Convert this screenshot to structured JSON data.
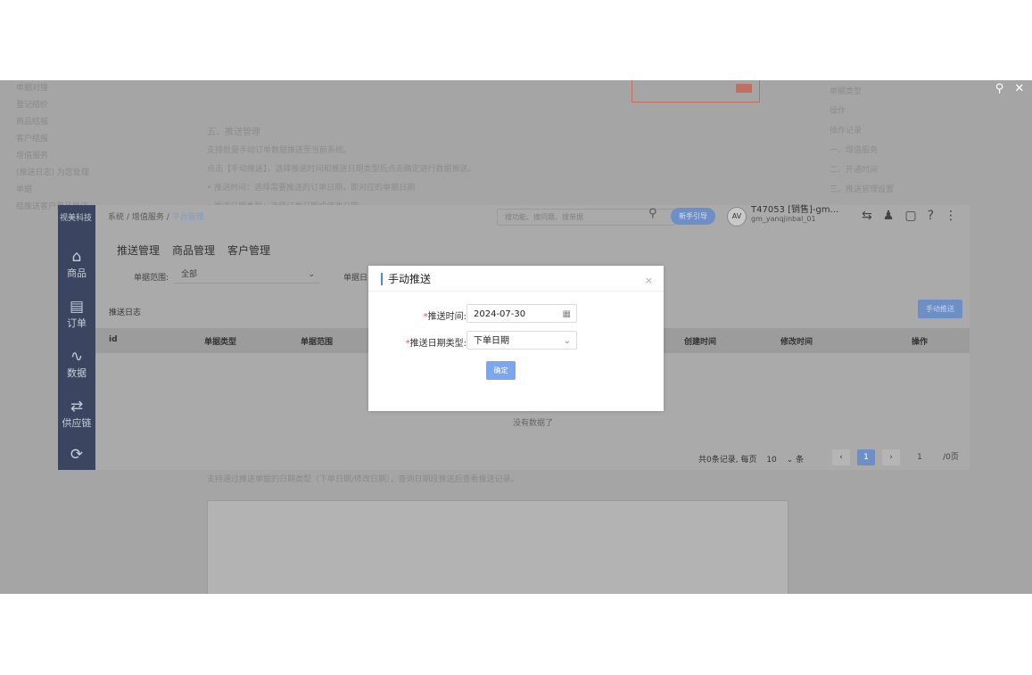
{
  "viewer": {
    "zoom_icon": "search-icon",
    "close_icon": "close-icon",
    "zoom_glyph": "⚲",
    "close_glyph": "✕"
  },
  "doc": {
    "sidebar_items": [
      "单据对接",
      "登记结价",
      "商品结报",
      "客户结报",
      "增值服务",
      "(推送日志) 为您处理单据",
      "结推送客户商品推送"
    ],
    "heading": "五、推送管理",
    "paragraphs": [
      "支持批量手动订单数据推送至当前系统。",
      "点击【手动推送】，选择推送时间和推送日期类型后点击确定进行数据推送。",
      "• 推送时间：选择需要推送的订单日期，即对应的单据日期",
      "• 推送日期类型：选择订单日期或修改日期"
    ],
    "right_items": [
      "单据类型",
      "操作",
      "操作记录",
      "一、增值服务",
      "二、开通时间",
      "三、推送管理设置"
    ],
    "bottom_line": "支持通过推送单据的日期类型（下单日期/修改日期），查询日期段推送后查看推送记录。"
  },
  "app": {
    "brand": "视美科技",
    "nav": [
      {
        "label": "商品",
        "glyph": "⌂"
      },
      {
        "label": "订单",
        "glyph": "▤"
      },
      {
        "label": "数据",
        "glyph": "∿"
      },
      {
        "label": "供应链",
        "glyph": "⇄"
      },
      {
        "label": "",
        "glyph": "⟳"
      }
    ],
    "breadcrumb": {
      "a": "系统",
      "b": "增值服务",
      "c": "平台管理",
      "sep": "/"
    },
    "search_placeholder": "搜功能、搜问题、搜单据",
    "search_glyph": "⚲",
    "new_button": "新手引导",
    "avatar": "AV",
    "user_name": "T47053 [销售]-gm...",
    "user_sub": "gm_yanqjinbal_01",
    "top_glyphs": [
      "⇆",
      "♟",
      "▢",
      "?",
      "⋮"
    ],
    "tabs": [
      "推送管理",
      "商品管理",
      "客户管理"
    ],
    "filter_label": "单据范围:",
    "filter_value": "全部",
    "filter_arrow": "⌄",
    "filter2_label": "单据日",
    "log_title": "推送日志",
    "push_button": "手动推送",
    "table_headers": [
      "id",
      "单据类型",
      "单据范围",
      "创建时间",
      "修改时间",
      "操作"
    ],
    "empty_text": "没有数据了",
    "pager": {
      "summary": "共0条记录, 每页",
      "per_page": "10",
      "unit": "条",
      "prev": "‹",
      "page": "1",
      "next": "›",
      "goto": "1",
      "total": "/0页"
    }
  },
  "modal": {
    "title": "手动推送",
    "close": "×",
    "required_mark": "*",
    "push_time_label": "推送时间:",
    "push_time_value": "2024-07-30",
    "calendar_glyph": "▦",
    "date_type_label": "推送日期类型:",
    "date_type_value": "下单日期",
    "dropdown_glyph": "⌄",
    "confirm": "确定"
  }
}
